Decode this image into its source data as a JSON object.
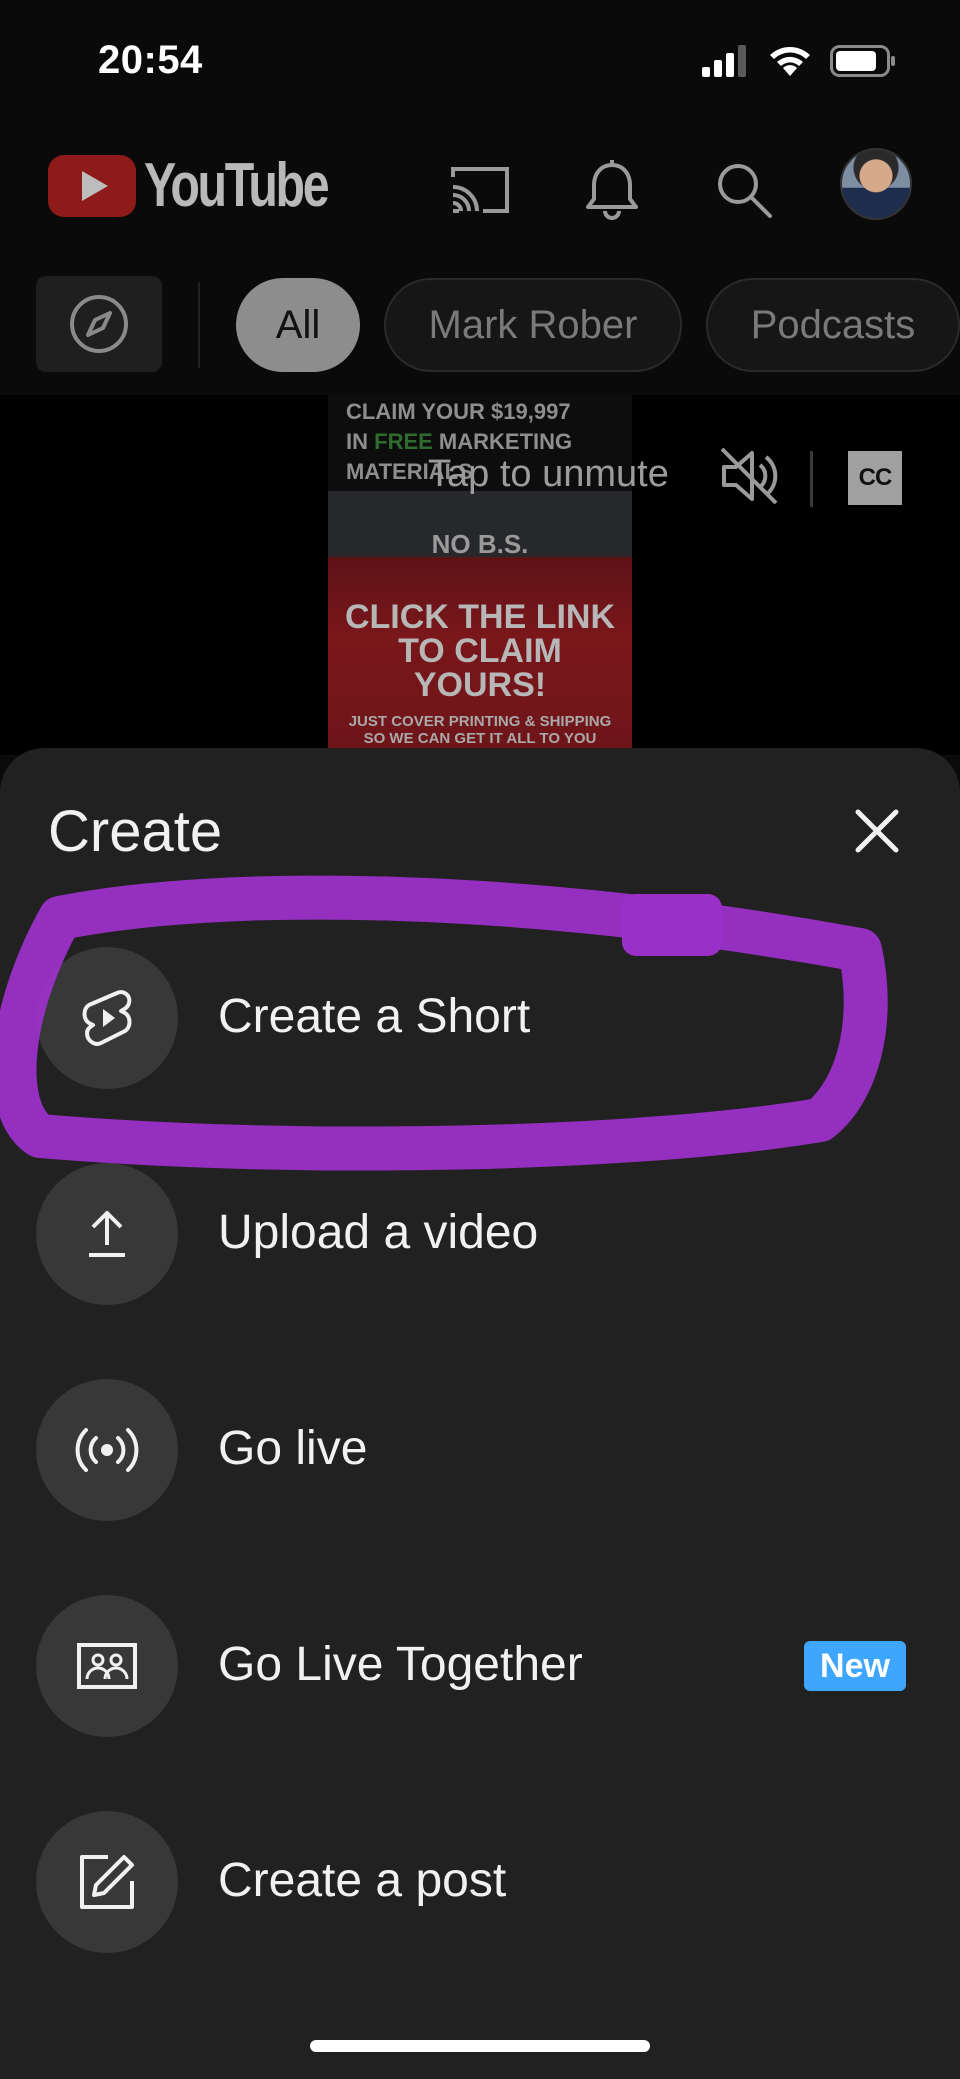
{
  "status_bar": {
    "time": "20:54",
    "icons": [
      "cellular-signal-icon",
      "wifi-icon",
      "battery-icon"
    ]
  },
  "header": {
    "logo_text": "YouTube",
    "icons": [
      "cast-icon",
      "notifications-bell-icon",
      "search-icon",
      "account-avatar"
    ]
  },
  "chips": {
    "explore_icon": "compass-icon",
    "items": [
      {
        "label": "All",
        "active": true
      },
      {
        "label": "Mark Rober",
        "active": false
      },
      {
        "label": "Podcasts",
        "active": false
      }
    ]
  },
  "video": {
    "ad_top_line1": "CLAIM YOUR $19,997",
    "ad_top_line2_a": "IN ",
    "ad_top_line2_b": "FREE",
    "ad_top_line2_c": " MARKETING",
    "ad_top_line3": "MATERIALS",
    "ad_nobs": "NO B.S.",
    "ad_claim_line1": "CLICK THE LINK",
    "ad_claim_line2": "TO CLAIM YOURS!",
    "ad_ship_line1": "JUST COVER PRINTING & SHIPPING",
    "ad_ship_line2": "SO WE CAN GET IT ALL TO YOU",
    "unmute_text": "Tap to unmute",
    "cc_label": "CC"
  },
  "sheet": {
    "title": "Create",
    "close_icon": "close-icon",
    "items": [
      {
        "label": "Create a Short",
        "icon": "shorts-icon"
      },
      {
        "label": "Upload a video",
        "icon": "upload-icon"
      },
      {
        "label": "Go live",
        "icon": "live-broadcast-icon"
      },
      {
        "label": "Go Live Together",
        "icon": "live-together-icon",
        "badge": "New"
      },
      {
        "label": "Create a post",
        "icon": "edit-post-icon"
      }
    ],
    "highlight_color": "#9b30c8",
    "badge_color": "#3ea6ff"
  }
}
